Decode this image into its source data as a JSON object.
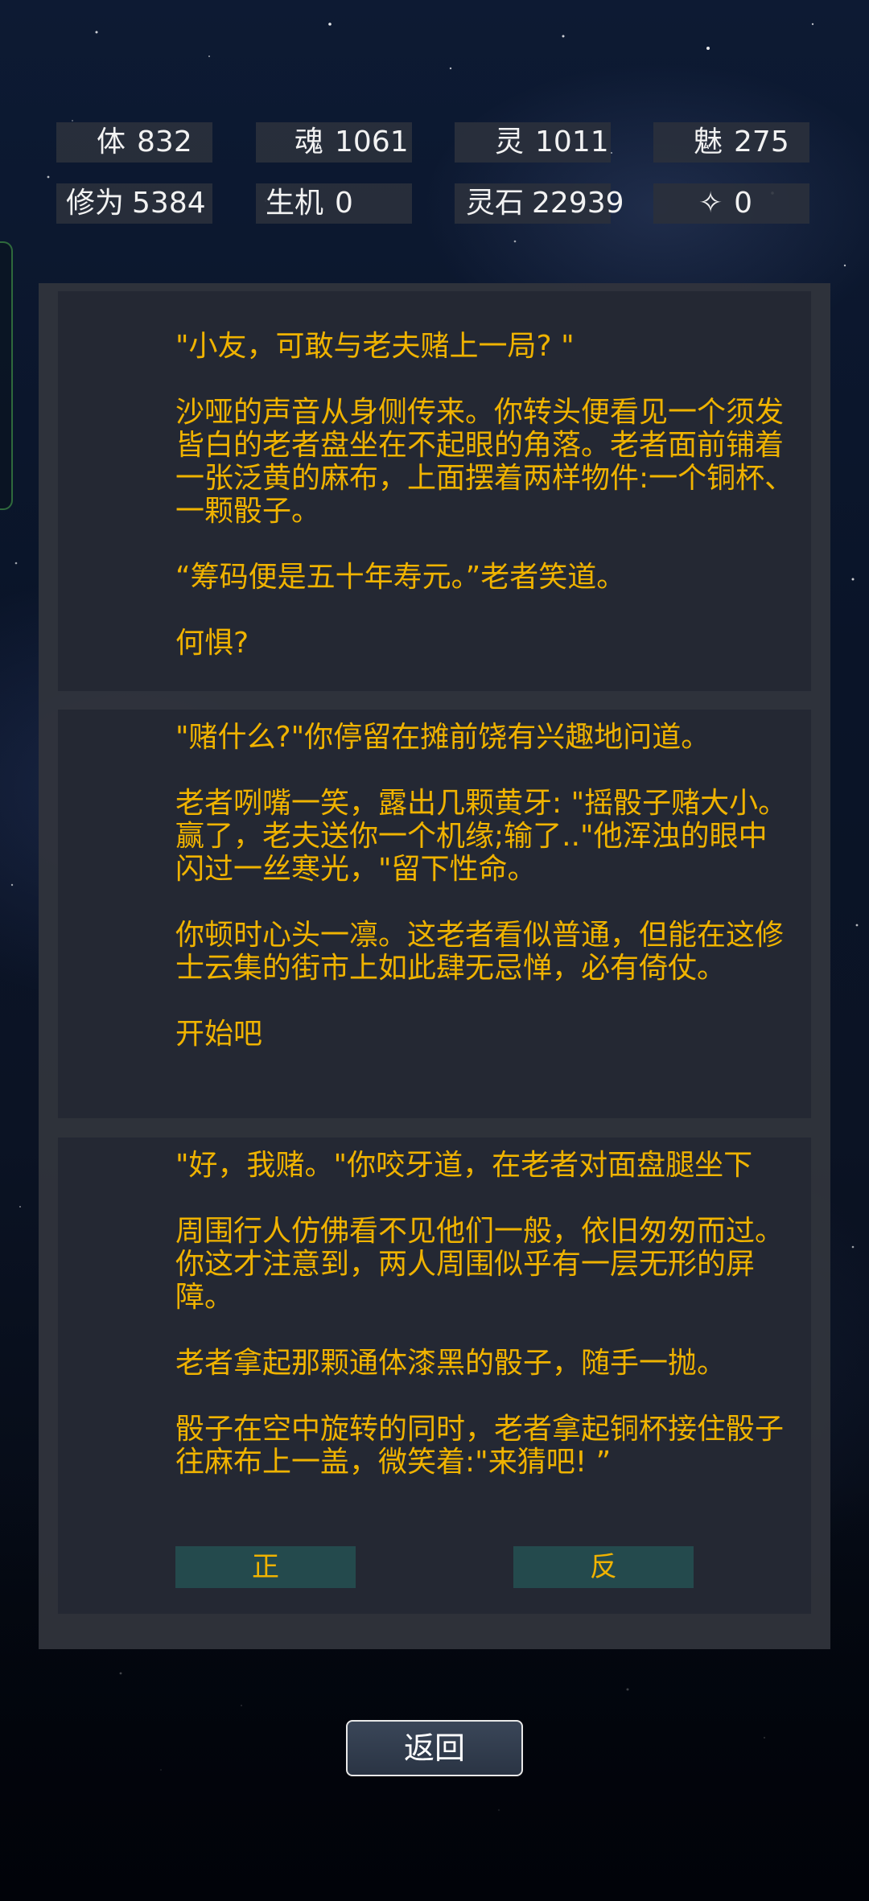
{
  "stats": [
    {
      "label": "体",
      "value": "832"
    },
    {
      "label": "魂",
      "value": "1061"
    },
    {
      "label": "灵",
      "value": "1011"
    },
    {
      "label": "魅",
      "value": "275"
    },
    {
      "label": "修为",
      "value": "5384"
    },
    {
      "label": "生机",
      "value": "0"
    },
    {
      "label": "灵石",
      "value": "22939"
    },
    {
      "label": "✧",
      "value": "0"
    }
  ],
  "story": {
    "card1": [
      "\"小友，可敢与老夫赌上一局? \"",
      "沙哑的声音从身侧传来。你转头便看见一个须发皆白的老者盘坐在不起眼的角落。老者面前铺着一张泛黄的麻布，上面摆着两样物件:一个铜杯、一颗骰子。",
      "“筹码便是五十年寿元。”老者笑道。",
      "何惧?"
    ],
    "card2": [
      "\"赌什么?\"你停留在摊前饶有兴趣地问道。",
      "老者咧嘴一笑，露出几颗黄牙: \"摇骰子赌大小。赢了，老夫送你一个机缘;输了..\"他浑浊的眼中闪过一丝寒光，\"留下性命。",
      "你顿时心头一凛。这老者看似普通，但能在这修士云集的街市上如此肆无忌惮，必有倚仗。",
      "开始吧"
    ],
    "card3": [
      "\"好，我赌。\"你咬牙道，在老者对面盘腿坐下",
      "周围行人仿佛看不见他们一般，依旧匆匆而过。你这才注意到，两人周围似乎有一层无形的屏障。",
      "老者拿起那颗通体漆黑的骰子，随手一抛。",
      "骰子在空中旋转的同时，老者拿起铜杯接住骰子往麻布上一盖，微笑着:\"来猜吧! ”"
    ]
  },
  "choices": {
    "heads": "正",
    "tails": "反"
  },
  "back_label": "返回"
}
